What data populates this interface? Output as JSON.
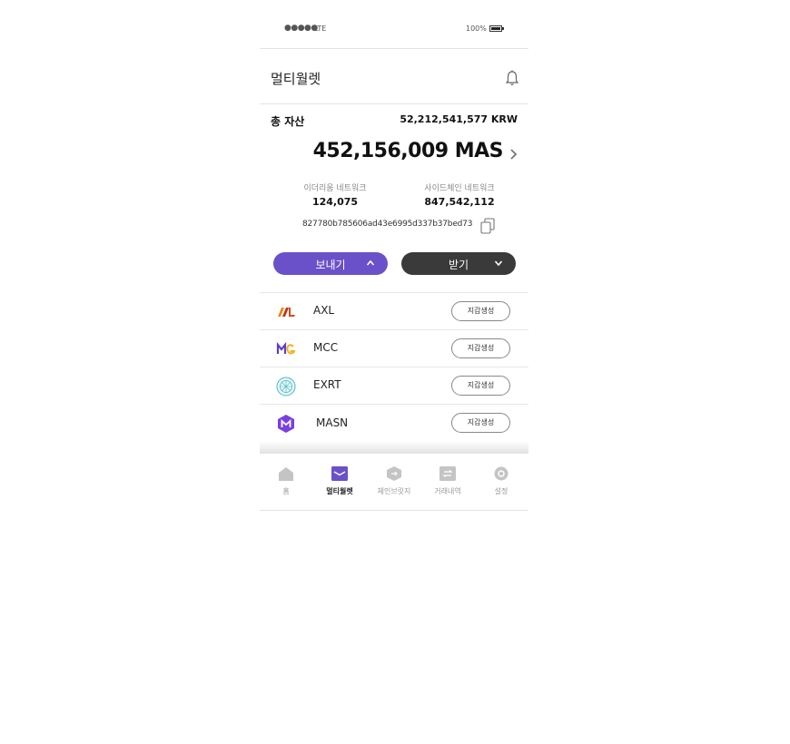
{
  "status_bar": {
    "signal": "●●●●●",
    "network": "LTE",
    "battery": "100%"
  },
  "header": {
    "title": "멀티월렛",
    "bell_icon": "bell-icon"
  },
  "total": {
    "label": "총 자산",
    "krw": "52,212,541,577 KRW"
  },
  "balance": {
    "amount": "452,156,009 MAS"
  },
  "networks": {
    "ethereum": {
      "label": "이더리움 네트워크",
      "value": "124,075"
    },
    "sidechain": {
      "label": "사이드체인 네트워크",
      "value": "847,542,112"
    }
  },
  "address": "827780b785606ad43e6995d337b37bed73",
  "buttons": {
    "send": "보내기",
    "receive": "받기"
  },
  "coins": [
    {
      "name": "AXL",
      "action": "지갑생성",
      "icon": "axl-logo-icon"
    },
    {
      "name": "MCC",
      "action": "지갑생성",
      "icon": "mcc-logo-icon"
    },
    {
      "name": "EXRT",
      "action": "지갑생성",
      "icon": "exrt-logo-icon"
    },
    {
      "name": "MASN",
      "action": "지갑생성",
      "icon": "masn-logo-icon"
    }
  ],
  "tabs": [
    {
      "label": "홈",
      "icon": "home-icon"
    },
    {
      "label": "멀티월렛",
      "icon": "wallet-icon",
      "active": true
    },
    {
      "label": "체인브릿지",
      "icon": "chain-bridge-icon"
    },
    {
      "label": "거래내역",
      "icon": "transactions-icon"
    },
    {
      "label": "설정",
      "icon": "settings-icon"
    }
  ],
  "colors": {
    "accent": "#6a51c9",
    "dark_button": "#3a3a3a",
    "inactive_tab": "#bbbbbb"
  }
}
